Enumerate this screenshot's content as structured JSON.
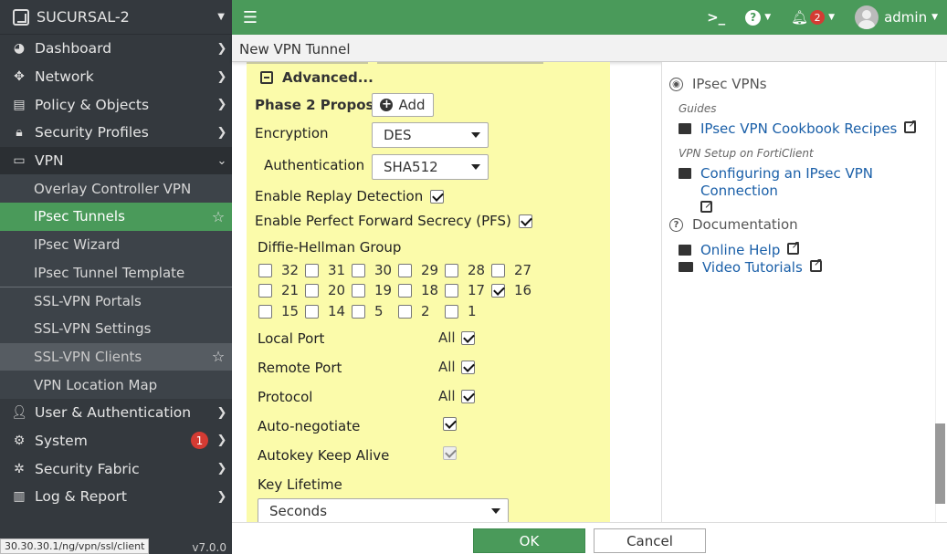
{
  "sidebar": {
    "device": "SUCURSAL-2",
    "items": [
      {
        "label": "Dashboard",
        "icon": "dashboard-icon"
      },
      {
        "label": "Network",
        "icon": "network-icon"
      },
      {
        "label": "Policy & Objects",
        "icon": "policy-icon"
      },
      {
        "label": "Security Profiles",
        "icon": "lock-icon"
      },
      {
        "label": "VPN",
        "icon": "vpn-icon"
      }
    ],
    "vpn_sub": [
      {
        "label": "Overlay Controller VPN"
      },
      {
        "label": "IPsec Tunnels"
      },
      {
        "label": "IPsec Wizard"
      },
      {
        "label": "IPsec Tunnel Template"
      },
      {
        "label": "SSL-VPN Portals"
      },
      {
        "label": "SSL-VPN Settings"
      },
      {
        "label": "SSL-VPN Clients"
      },
      {
        "label": "VPN Location Map"
      }
    ],
    "items_after": [
      {
        "label": "User & Authentication",
        "icon": "user-icon"
      },
      {
        "label": "System",
        "icon": "gear-icon",
        "badge": "1"
      },
      {
        "label": "Security Fabric",
        "icon": "fabric-icon"
      },
      {
        "label": "Log & Report",
        "icon": "chart-icon"
      }
    ],
    "status_url": "30.30.30.1/ng/vpn/ssl/client",
    "version": "v7.0.0"
  },
  "topbar": {
    "cli": ">_",
    "help": "?",
    "alerts": "2",
    "user": "admin"
  },
  "title": "New VPN Tunnel",
  "form": {
    "advanced_label": "Advanced...",
    "phase2_label": "Phase 2 Proposal",
    "add_label": "Add",
    "encryption_label": "Encryption",
    "encryption_value": "DES",
    "authentication_label": "Authentication",
    "authentication_value": "SHA512",
    "replay_label": "Enable Replay Detection",
    "replay_checked": true,
    "pfs_label": "Enable Perfect Forward Secrecy (PFS)",
    "pfs_checked": true,
    "dh_label": "Diffie-Hellman Group",
    "dh_groups": [
      {
        "label": "32",
        "checked": false
      },
      {
        "label": "31",
        "checked": false
      },
      {
        "label": "30",
        "checked": false
      },
      {
        "label": "29",
        "checked": false
      },
      {
        "label": "28",
        "checked": false
      },
      {
        "label": "27",
        "checked": false
      },
      {
        "label": "21",
        "checked": false
      },
      {
        "label": "20",
        "checked": false
      },
      {
        "label": "19",
        "checked": false
      },
      {
        "label": "18",
        "checked": false
      },
      {
        "label": "17",
        "checked": false
      },
      {
        "label": "16",
        "checked": true
      },
      {
        "label": "15",
        "checked": false
      },
      {
        "label": "14",
        "checked": false
      },
      {
        "label": "5",
        "checked": false
      },
      {
        "label": "2",
        "checked": false
      },
      {
        "label": "1",
        "checked": false
      }
    ],
    "local_port_label": "Local Port",
    "remote_port_label": "Remote Port",
    "protocol_label": "Protocol",
    "all_label": "All",
    "auto_negotiate_label": "Auto-negotiate",
    "keepalive_label": "Autokey Keep Alive",
    "lifetime_label": "Key Lifetime",
    "lifetime_value": "Seconds"
  },
  "help": {
    "section1": "IPsec VPNs",
    "guides": "Guides",
    "cookbook": "IPsec VPN Cookbook Recipes",
    "forticlient": "VPN Setup on FortiClient",
    "configuring": "Configuring an IPsec VPN Connection",
    "section2": "Documentation",
    "online_help": "Online Help",
    "video_tutorials": "Video Tutorials"
  },
  "actions": {
    "ok": "OK",
    "cancel": "Cancel"
  },
  "colors": {
    "accent": "#4a9a5a",
    "sidebar_bg": "#34393e",
    "form_bg": "#fbfbaa",
    "badge": "#d43b33"
  }
}
